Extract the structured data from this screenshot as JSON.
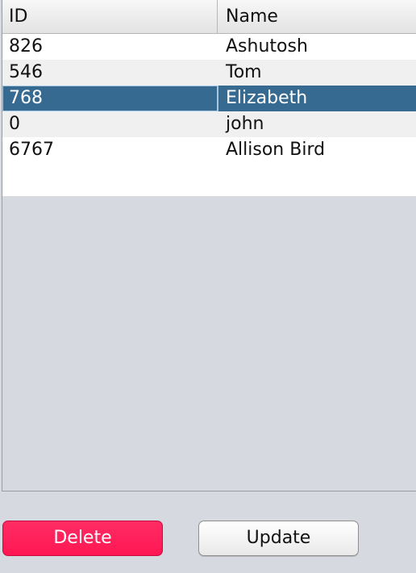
{
  "table": {
    "columns": [
      "ID",
      "Name"
    ],
    "rows": [
      {
        "id": "826",
        "name": "Ashutosh"
      },
      {
        "id": "546",
        "name": "Tom"
      },
      {
        "id": "768",
        "name": "Elizabeth",
        "selected": true
      },
      {
        "id": "0",
        "name": "john"
      },
      {
        "id": "6767",
        "name": "Allison Bird"
      }
    ]
  },
  "actions": {
    "delete_label": "Delete",
    "update_label": "Update"
  },
  "colors": {
    "selected_row": "#376a91",
    "delete_button": "#ff1f5a",
    "background": "#d6d9df"
  }
}
